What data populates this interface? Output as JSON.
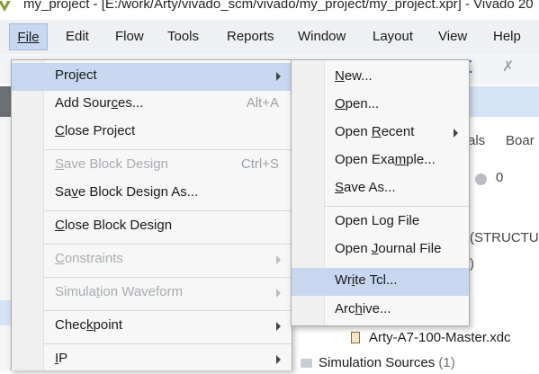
{
  "window": {
    "title": "my_project - [E:/work/Arty/vivado_scm/vivado/my_project/my_project.xpr] - Vivado 20"
  },
  "menubar": [
    "File",
    "Edit",
    "Flow",
    "Tools",
    "Reports",
    "Window",
    "Layout",
    "View",
    "Help"
  ],
  "toolbar_icons": [
    "sigma-icon",
    "pin-icon"
  ],
  "background": {
    "tab_partial": "als",
    "tab2_partial": "Boar",
    "count": "0",
    "structure_partial": "(STRUCTUR",
    "paren_partial": ")",
    "xdc_file": "Arty-A7-100-Master.xdc",
    "sim_sources": "Simulation Sources",
    "sim_count": "(1)"
  },
  "file_menu": {
    "items": [
      {
        "pre": "",
        "u": "",
        "post": "Project",
        "submenu": true,
        "highlight": true
      },
      {
        "pre": "Add Sour",
        "u": "c",
        "post": "es...",
        "shortcut": "Alt+A"
      },
      {
        "pre": "",
        "u": "C",
        "post": "lose Project"
      },
      {
        "pre": "",
        "u": "S",
        "post": "ave Block Design",
        "shortcut": "Ctrl+S",
        "disabled": true
      },
      {
        "pre": "Sa",
        "u": "v",
        "post": "e Block Design As..."
      },
      {
        "pre": "",
        "u": "C",
        "post": "lose Block Design"
      },
      {
        "pre": "",
        "u": "C",
        "post": "onstraints",
        "submenu": true,
        "disabled": true
      },
      {
        "pre": "Simula",
        "u": "t",
        "post": "ion Waveform",
        "submenu": true,
        "disabled": true
      },
      {
        "pre": "Chec",
        "u": "k",
        "post": "point",
        "submenu": true
      },
      {
        "pre": "",
        "u": "I",
        "post": "P",
        "submenu": true
      }
    ]
  },
  "project_menu": {
    "items": [
      {
        "pre": "",
        "u": "N",
        "post": "ew..."
      },
      {
        "pre": "",
        "u": "O",
        "post": "pen..."
      },
      {
        "pre": "Open ",
        "u": "R",
        "post": "ecent",
        "submenu": true
      },
      {
        "pre": "Open Exa",
        "u": "m",
        "post": "ple..."
      },
      {
        "pre": "",
        "u": "S",
        "post": "ave As..."
      },
      {
        "pre": "Open Lo",
        "u": "g",
        "post": " File"
      },
      {
        "pre": "Open ",
        "u": "J",
        "post": "ournal File"
      },
      {
        "pre": "Wr",
        "u": "i",
        "post": "te Tcl...",
        "highlight": true
      },
      {
        "pre": "Arc",
        "u": "h",
        "post": "ive..."
      }
    ]
  }
}
